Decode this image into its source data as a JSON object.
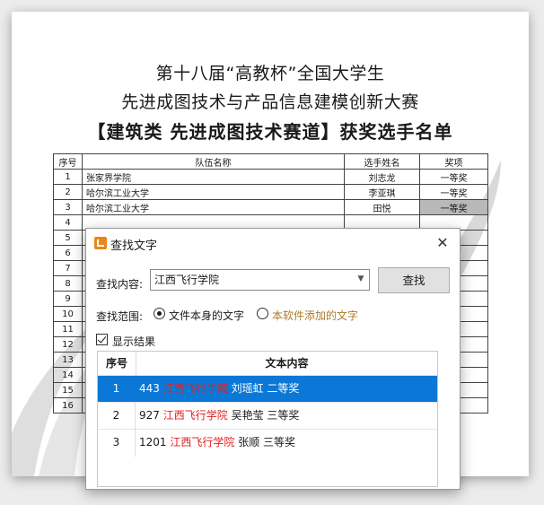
{
  "document": {
    "title_line1": "第十八届“高教杯”全国大学生",
    "title_line2": "先进成图技术与产品信息建模创新大赛",
    "title_line3": "【建筑类  先进成图技术赛道】获奖选手名单",
    "table": {
      "headers": [
        "序号",
        "队伍名称",
        "选手姓名",
        "奖项"
      ],
      "rows": [
        {
          "num": "1",
          "team": "张家界学院",
          "name": "刘志龙",
          "award": "一等奖"
        },
        {
          "num": "2",
          "team": "哈尔滨工业大学",
          "name": "李亚琪",
          "award": "一等奖"
        },
        {
          "num": "3",
          "team": "哈尔滨工业大学",
          "name": "田悦",
          "award": "一等奖"
        },
        {
          "num": "4"
        },
        {
          "num": "5"
        },
        {
          "num": "6"
        },
        {
          "num": "7"
        },
        {
          "num": "8"
        },
        {
          "num": "9"
        },
        {
          "num": "10"
        },
        {
          "num": "11"
        },
        {
          "num": "12"
        },
        {
          "num": "13"
        },
        {
          "num": "14"
        },
        {
          "num": "15"
        },
        {
          "num": "16"
        }
      ]
    }
  },
  "dialog": {
    "title": "查找文字",
    "close_glyph": "✕",
    "find_label": "查找内容:",
    "find_value": "江西飞行学院",
    "find_button": "查找",
    "scope_label": "查找范围:",
    "scope_option1": "文件本身的文字",
    "scope_option2": "本软件添加的文字",
    "show_results_label": "显示结果",
    "results": {
      "header_seq": "序号",
      "header_text": "文本内容",
      "rows": [
        {
          "seq": "1",
          "id": "443",
          "hit": "江西飞行学院",
          "rest": "刘瑶虹 二等奖"
        },
        {
          "seq": "2",
          "id": "927",
          "hit": "江西飞行学院",
          "rest": "吴艳莹 三等奖"
        },
        {
          "seq": "3",
          "id": "1201",
          "hit": "江西飞行学院",
          "rest": "张顺 三等奖"
        }
      ]
    }
  },
  "colors": {
    "selection": "#0b78d7",
    "hit_text": "#e02020",
    "logo": "#e8861a",
    "scope_option2_text": "#b07a2a"
  }
}
